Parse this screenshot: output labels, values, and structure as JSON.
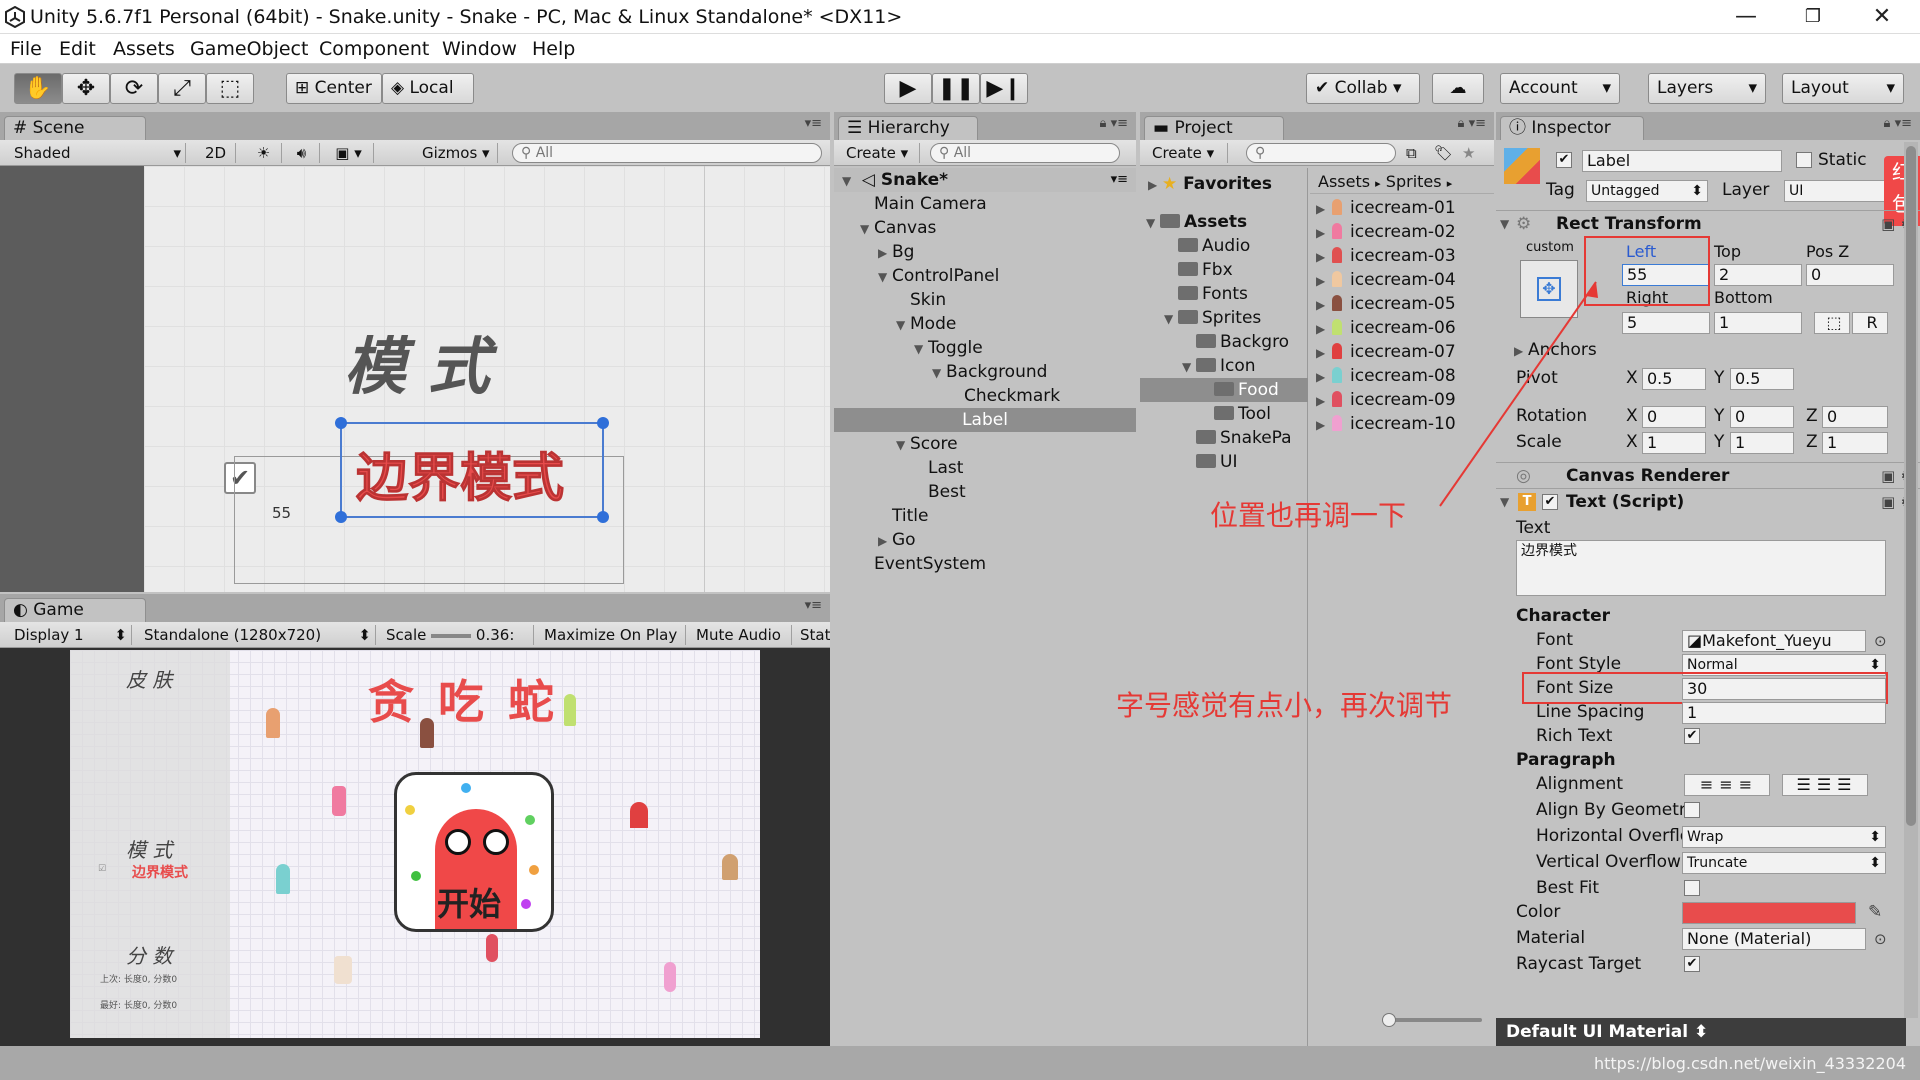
{
  "window": {
    "title": "Unity 5.6.7f1 Personal (64bit) - Snake.unity - Snake - PC, Mac & Linux Standalone* <DX11>"
  },
  "menu": [
    "File",
    "Edit",
    "Assets",
    "GameObject",
    "Component",
    "Window",
    "Help"
  ],
  "toolbar": {
    "center": "Center",
    "local": "Local",
    "collab": "Collab",
    "account": "Account",
    "layers": "Layers",
    "layout": "Layout"
  },
  "scene": {
    "tab": "Scene",
    "shading": "Shaded",
    "mode2d": "2D",
    "gizmos": "Gizmos",
    "search_placeholder": "All",
    "title_text": "模 式",
    "label_text": "边界模式",
    "checkbox_value": "55"
  },
  "game": {
    "tab": "Game",
    "display": "Display 1",
    "resolution": "Standalone (1280x720)",
    "scale_label": "Scale",
    "scale_value": "0.36:",
    "maximize": "Maximize On Play",
    "mute": "Mute Audio",
    "stats": "Stat",
    "skin": "皮 肤",
    "title": "贪 吃 蛇",
    "mode": "模 式",
    "mode_label": "边界模式",
    "score": "分 数",
    "score_last": "上次: 长度0, 分数0",
    "score_best": "最好: 长度0, 分数0",
    "start": "开始"
  },
  "hierarchy": {
    "tab": "Hierarchy",
    "create": "Create",
    "search_placeholder": "All",
    "scene": "Snake*",
    "items": [
      {
        "label": "Main Camera",
        "depth": 1,
        "arrow": ""
      },
      {
        "label": "Canvas",
        "depth": 1,
        "arrow": "▼"
      },
      {
        "label": "Bg",
        "depth": 2,
        "arrow": "▶"
      },
      {
        "label": "ControlPanel",
        "depth": 2,
        "arrow": "▼"
      },
      {
        "label": "Skin",
        "depth": 3,
        "arrow": ""
      },
      {
        "label": "Mode",
        "depth": 3,
        "arrow": "▼"
      },
      {
        "label": "Toggle",
        "depth": 4,
        "arrow": "▼"
      },
      {
        "label": "Background",
        "depth": 5,
        "arrow": "▼"
      },
      {
        "label": "Checkmark",
        "depth": 6,
        "arrow": ""
      },
      {
        "label": "Label",
        "depth": 6,
        "arrow": "",
        "selected": true
      },
      {
        "label": "Score",
        "depth": 3,
        "arrow": "▼"
      },
      {
        "label": "Last",
        "depth": 4,
        "arrow": ""
      },
      {
        "label": "Best",
        "depth": 4,
        "arrow": ""
      },
      {
        "label": "Title",
        "depth": 2,
        "arrow": ""
      },
      {
        "label": "Go",
        "depth": 2,
        "arrow": "▶"
      },
      {
        "label": "EventSystem",
        "depth": 1,
        "arrow": ""
      }
    ]
  },
  "project": {
    "tab": "Project",
    "create": "Create",
    "favorites": "Favorites",
    "breadcrumb": [
      "Assets",
      "Sprites"
    ],
    "tree": [
      {
        "label": "Assets",
        "depth": 0,
        "arrow": "▼",
        "bold": true
      },
      {
        "label": "Audio",
        "depth": 1,
        "arrow": ""
      },
      {
        "label": "Fbx",
        "depth": 1,
        "arrow": ""
      },
      {
        "label": "Fonts",
        "depth": 1,
        "arrow": ""
      },
      {
        "label": "Sprites",
        "depth": 1,
        "arrow": "▼"
      },
      {
        "label": "Backgro",
        "depth": 2,
        "arrow": ""
      },
      {
        "label": "Icon",
        "depth": 2,
        "arrow": "▼"
      },
      {
        "label": "Food",
        "depth": 3,
        "arrow": "",
        "selected": true
      },
      {
        "label": "Tool",
        "depth": 3,
        "arrow": ""
      },
      {
        "label": "SnakePa",
        "depth": 2,
        "arrow": ""
      },
      {
        "label": "UI",
        "depth": 2,
        "arrow": ""
      }
    ],
    "assets": [
      "icecream-01",
      "icecream-02",
      "icecream-03",
      "icecream-04",
      "icecream-05",
      "icecream-06",
      "icecream-07",
      "icecream-08",
      "icecream-09",
      "icecream-10"
    ],
    "asset_colors": [
      "#e8a070",
      "#f07aa0",
      "#e05050",
      "#f0c8a0",
      "#8a5040",
      "#c0e070",
      "#e04040",
      "#7ad0d0",
      "#e05060",
      "#f0a0d0"
    ]
  },
  "inspector": {
    "tab": "Inspector",
    "name": "Label",
    "static": "Static",
    "tag_label": "Tag",
    "tag": "Untagged",
    "layer_label": "Layer",
    "layer": "UI",
    "rect_transform": "Rect Transform",
    "anchor_preset": "custom",
    "left_label": "Left",
    "left": "55",
    "top_label": "Top",
    "top": "2",
    "posz_label": "Pos Z",
    "posz": "0",
    "right_label": "Right",
    "right": "5",
    "bottom_label": "Bottom",
    "bottom": "1",
    "r_button": "R",
    "anchors": "Anchors",
    "pivot": "Pivot",
    "pivot_x": "0.5",
    "pivot_y": "0.5",
    "rotation": "Rotation",
    "rot_x": "0",
    "rot_y": "0",
    "rot_z": "0",
    "scale": "Scale",
    "scale_x": "1",
    "scale_y": "1",
    "scale_z": "1",
    "canvas_renderer": "Canvas Renderer",
    "text_script": "Text (Script)",
    "text_label": "Text",
    "text_value": "边界模式",
    "character": "Character",
    "font_label": "Font",
    "font": "Makefont_Yueyu",
    "font_style_label": "Font Style",
    "font_style": "Normal",
    "font_size_label": "Font Size",
    "font_size": "30",
    "line_spacing_label": "Line Spacing",
    "line_spacing": "1",
    "rich_text": "Rich Text",
    "paragraph": "Paragraph",
    "alignment": "Alignment",
    "align_by_geometry": "Align By Geometr",
    "h_overflow_label": "Horizontal Overflo",
    "h_overflow": "Wrap",
    "v_overflow_label": "Vertical Overflow",
    "v_overflow": "Truncate",
    "best_fit": "Best Fit",
    "color_label": "Color",
    "color": "#e84c4c",
    "material_label": "Material",
    "material": "None (Material)",
    "raycast": "Raycast Target",
    "default_material": "Default UI Material"
  },
  "annotations": {
    "position": "位置也再调一下",
    "font_size": "字号感觉有点小，再次调节",
    "side_badge": "红包"
  },
  "watermark": "https://blog.csdn.net/weixin_43332204"
}
